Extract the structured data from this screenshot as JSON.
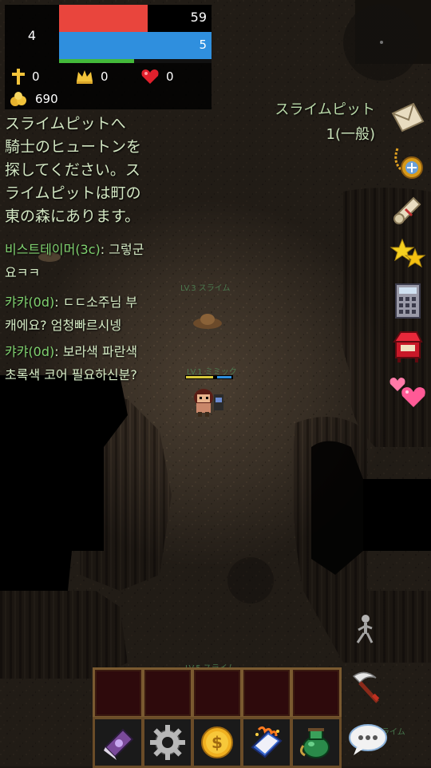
{
  "hud": {
    "level": "4",
    "hp": "59",
    "hp_fraction": 0.58,
    "mp": "5",
    "mp_fraction": 1.0,
    "exp_fraction": 0.49,
    "ankh_count": "0",
    "crown_count": "0",
    "heart_count": "0",
    "gold": "690"
  },
  "quest": {
    "lines": [
      "スライムピットへ",
      "騎士のヒュートンを",
      "探してください。ス",
      "ライムピットは町の",
      "東の森にあります。"
    ],
    "tracker_name": "スライムピット",
    "tracker_status": "1(一般)"
  },
  "chat": [
    {
      "name": "비스트테이머(3c)",
      "lines": [
        ": 그렇군",
        "요ㅋㅋ"
      ]
    },
    {
      "name": "캬캬(0d)",
      "lines": [
        ": ㄷㄷ소주님 부",
        "캐에요? 엄청빠르시넹"
      ]
    },
    {
      "name": "캬캬(0d)",
      "lines": [
        ": 보라색 파란색",
        "초록색 코어 필요하신분?"
      ]
    }
  ],
  "map_labels": {
    "slime_label": "LV.3 スライム",
    "player_label": "LV.1 ミミック",
    "bottom_label_1": "LV.5 スライム",
    "bottom_label_2": "スライム"
  },
  "side_icons": [
    "mail-icon",
    "amulet-icon",
    "scroll-icon",
    "stars-icon",
    "calculator-icon",
    "shop-stand-icon",
    "hearts-icon"
  ],
  "bottom_bar": {
    "slots": [
      "",
      "",
      "",
      "",
      ""
    ],
    "buttons": [
      "spellbook-icon",
      "settings-gear-icon",
      "gold-coin-icon",
      "magic-tome-icon",
      "potion-bag-icon"
    ]
  },
  "colors": {
    "hp": "#e9453d",
    "mp": "#2f8fde",
    "exp": "#43b93a",
    "quest_text": "#d2e6c2",
    "chat_name": "#7fd16f"
  }
}
